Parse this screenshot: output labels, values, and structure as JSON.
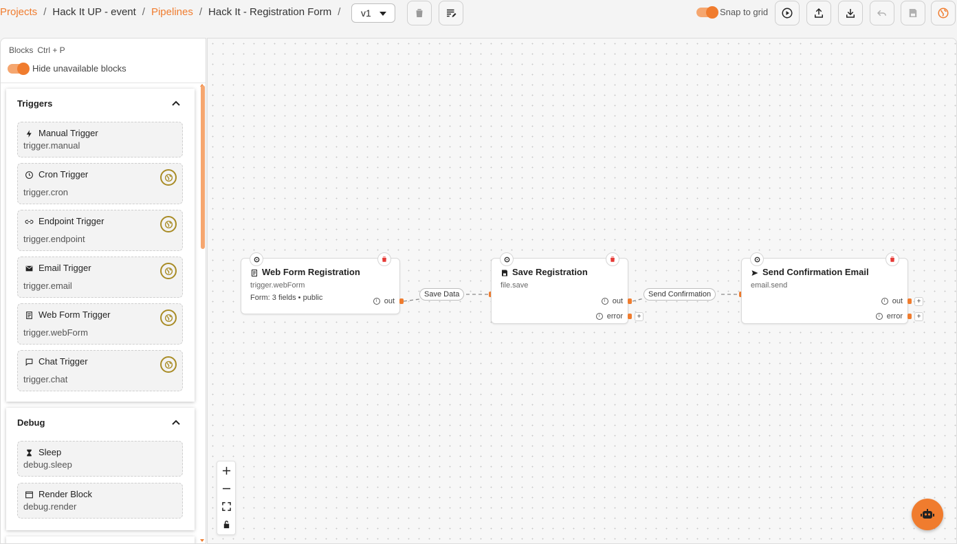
{
  "breadcrumb": {
    "projects": "Projects",
    "project": "Hack It UP - event",
    "pipelines": "Pipelines",
    "pipeline": "Hack It - Registration Form",
    "separator": "/"
  },
  "version": {
    "selected": "v1"
  },
  "toolbar": {
    "snap_label": "Snap to grid",
    "snap_enabled": true,
    "icons": [
      "trash-icon",
      "edit-notes-icon",
      "play-icon",
      "upload-icon",
      "download-icon",
      "undo-icon",
      "save-icon",
      "globe-icon"
    ]
  },
  "sidebar": {
    "title": "Blocks",
    "shortcut": "Ctrl + P",
    "hide_unavailable_label": "Hide unavailable blocks",
    "groups": [
      {
        "title": "Triggers",
        "blocks": [
          {
            "name": "Manual Trigger",
            "id": "trigger.manual",
            "icon": "bolt-icon",
            "public": false
          },
          {
            "name": "Cron Trigger",
            "id": "trigger.cron",
            "icon": "clock-icon",
            "public": true
          },
          {
            "name": "Endpoint Trigger",
            "id": "trigger.endpoint",
            "icon": "link-icon",
            "public": true
          },
          {
            "name": "Email Trigger",
            "id": "trigger.email",
            "icon": "mail-icon",
            "public": true
          },
          {
            "name": "Web Form Trigger",
            "id": "trigger.webForm",
            "icon": "form-icon",
            "public": true
          },
          {
            "name": "Chat Trigger",
            "id": "trigger.chat",
            "icon": "chat-icon",
            "public": true
          }
        ]
      },
      {
        "title": "Debug",
        "blocks": [
          {
            "name": "Sleep",
            "id": "debug.sleep",
            "icon": "hourglass-icon",
            "public": false
          },
          {
            "name": "Render Block",
            "id": "debug.render",
            "icon": "window-icon",
            "public": false
          }
        ]
      }
    ]
  },
  "canvas": {
    "nodes": [
      {
        "title": "Web Form Registration",
        "id": "trigger.webForm",
        "desc": "Form: 3 fields • public",
        "out": "out"
      },
      {
        "title": "Save Registration",
        "id": "file.save",
        "out": "out",
        "error": "error"
      },
      {
        "title": "Send Confirmation Email",
        "id": "email.send",
        "out": "out",
        "error": "error"
      }
    ],
    "edges": [
      {
        "label": "Save Data"
      },
      {
        "label": "Send Confirmation"
      }
    ],
    "plus": "+"
  },
  "colors": {
    "accent": "#f07c2e",
    "globe_badge": "#a88b24",
    "trash_red": "#e53935"
  }
}
